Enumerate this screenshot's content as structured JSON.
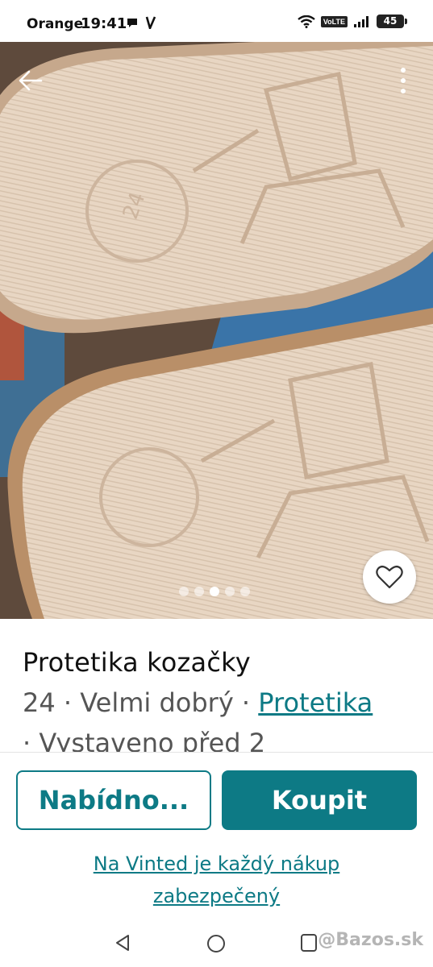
{
  "status_bar": {
    "carrier": "Orange",
    "time": "19:41",
    "volte": "VoLTE",
    "battery": "45"
  },
  "gallery": {
    "image_count": 5,
    "active_index": 2
  },
  "item": {
    "title": "Protetika kozačky",
    "size": "24",
    "condition": "Velmi dobrý",
    "brand": "Protetika",
    "separator": " · ",
    "posted": "· Vystaveno před 2"
  },
  "actions": {
    "offer_label": "Nabídno...",
    "buy_label": "Koupit",
    "safe_link": "Na Vinted je každý nákup zabezpečený"
  },
  "watermark": "@Bazos.sk",
  "colors": {
    "accent": "#0d7a85"
  }
}
